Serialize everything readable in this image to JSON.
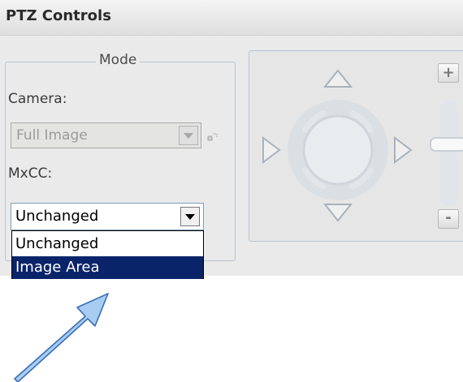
{
  "window": {
    "title": "PTZ Controls"
  },
  "mode": {
    "legend": "Mode",
    "camera": {
      "label": "Camera:",
      "value": "Full Image",
      "disabled": true
    },
    "mxcc": {
      "label": "MxCC:",
      "value": "Unchanged",
      "options": [
        "Unchanged",
        "Image Area"
      ],
      "highlighted_index": 1
    }
  },
  "ptz": {
    "zoom_in_label": "+",
    "zoom_out_label": "-"
  },
  "colors": {
    "highlight": "#0a246a",
    "annotation_arrow": "#a8cdf2",
    "annotation_arrow_border": "#3a6fb5"
  }
}
